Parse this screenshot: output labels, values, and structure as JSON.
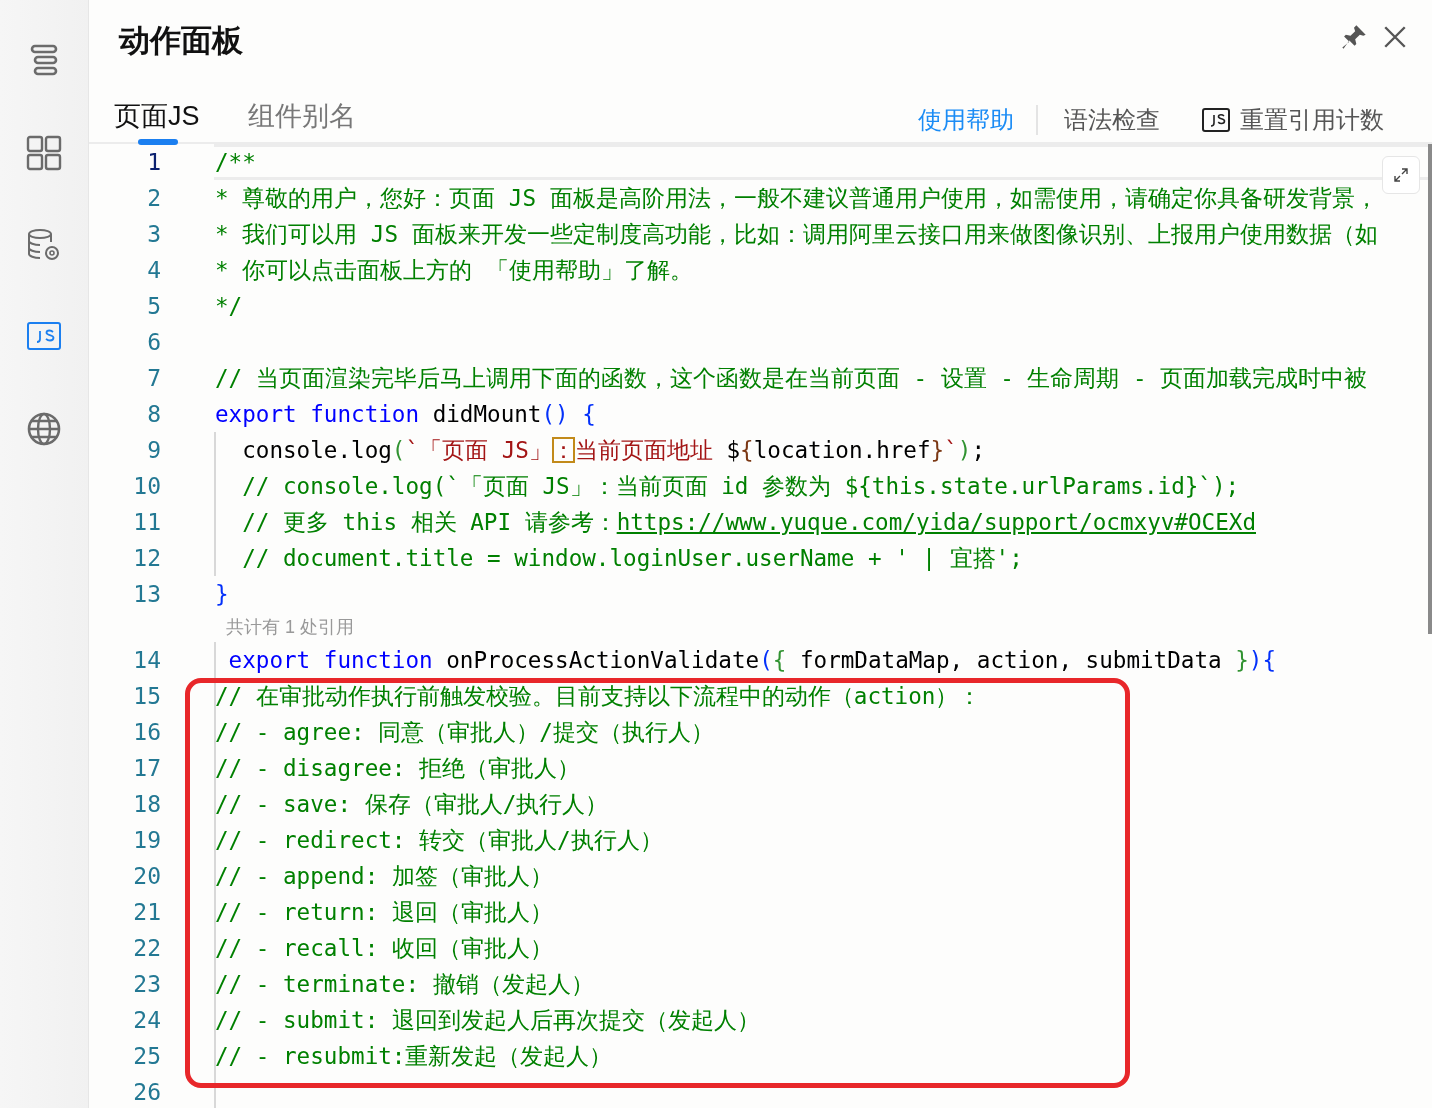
{
  "sidebar": {
    "items": [
      {
        "kind": "outline",
        "selected": false
      },
      {
        "kind": "components",
        "selected": false
      },
      {
        "kind": "datasource",
        "selected": false
      },
      {
        "kind": "js",
        "selected": true
      },
      {
        "kind": "globe",
        "selected": false
      }
    ]
  },
  "panel": {
    "title": "动作面板"
  },
  "tabs": [
    {
      "label": "页面JS",
      "selected": true
    },
    {
      "label": "组件别名",
      "selected": false
    }
  ],
  "actions": [
    {
      "kind": "link",
      "label": "使用帮助"
    },
    {
      "kind": "plain",
      "label": "语法检查"
    },
    {
      "kind": "js",
      "label": "重置引用计数"
    }
  ],
  "editor": {
    "lines": [
      {
        "kind": "code",
        "number": "1",
        "current": true,
        "tokens": [
          {
            "kind": "comment",
            "text": "/**"
          }
        ]
      },
      {
        "kind": "code",
        "number": "2",
        "current": false,
        "tokens": [
          {
            "kind": "comment",
            "text": "* 尊敬的用户，您好：页面 JS 面板是高阶用法，一般不建议普通用户使用，如需使用，请确定你具备研发背景，"
          }
        ]
      },
      {
        "kind": "code",
        "number": "3",
        "current": false,
        "tokens": [
          {
            "kind": "comment",
            "text": "* 我们可以用 JS 面板来开发一些定制度高功能，比如：调用阿里云接口用来做图像识别、上报用户使用数据（如"
          }
        ]
      },
      {
        "kind": "code",
        "number": "4",
        "current": false,
        "tokens": [
          {
            "kind": "comment",
            "text": "* 你可以点击面板上方的 「使用帮助」了解。"
          }
        ]
      },
      {
        "kind": "code",
        "number": "5",
        "current": false,
        "tokens": [
          {
            "kind": "comment",
            "text": "*/"
          }
        ]
      },
      {
        "kind": "code",
        "number": "6",
        "current": false
      },
      {
        "kind": "code",
        "number": "7",
        "current": false,
        "tokens": [
          {
            "kind": "comment",
            "text": "// 当页面渲染完毕后马上调用下面的函数，这个函数是在当前页面 - 设置 - 生命周期 - 页面加载完成时中被"
          }
        ]
      },
      {
        "kind": "code",
        "number": "8",
        "current": false,
        "tokens": [
          {
            "kind": "keyword",
            "text": "export function"
          },
          {
            "kind": "plain",
            "text": " didMount"
          },
          {
            "kind": "bracket1",
            "text": "() {"
          }
        ]
      },
      {
        "kind": "code",
        "number": "9",
        "current": false,
        "tokens": [
          {
            "kind": "plain",
            "text": "  console.log"
          },
          {
            "kind": "bracket2",
            "text": "("
          },
          {
            "kind": "string",
            "text": "`「页面 JS」"
          },
          {
            "kind": "match",
            "text": "："
          },
          {
            "kind": "string",
            "text": "当前页面地址 "
          },
          {
            "kind": "plain",
            "text": "$"
          },
          {
            "kind": "bracket3",
            "text": "{"
          },
          {
            "kind": "plain",
            "text": "location.href"
          },
          {
            "kind": "bracket3",
            "text": "}"
          },
          {
            "kind": "string",
            "text": "`"
          },
          {
            "kind": "bracket2",
            "text": ")"
          },
          {
            "kind": "plain",
            "text": ";"
          }
        ]
      },
      {
        "kind": "code",
        "number": "10",
        "current": false,
        "tokens": [
          {
            "kind": "comment",
            "text": "  // console.log(`「页面 JS」：当前页面 id 参数为 ${this.state.urlParams.id}`);"
          }
        ]
      },
      {
        "kind": "code",
        "number": "11",
        "current": false,
        "tokens": [
          {
            "kind": "comment",
            "text": "  // 更多 this 相关 API 请参考："
          },
          {
            "kind": "link",
            "text": "https://www.yuque.com/yida/support/ocmxyv#OCEXd"
          }
        ]
      },
      {
        "kind": "code",
        "number": "12",
        "current": false,
        "tokens": [
          {
            "kind": "comment",
            "text": "  // document.title = window.loginUser.userName + ' | 宜搭';"
          }
        ]
      },
      {
        "kind": "code",
        "number": "13",
        "current": false,
        "tokens": [
          {
            "kind": "bracket1",
            "text": "}"
          }
        ]
      },
      {
        "kind": "codelens",
        "text": "共计有 1 处引用"
      },
      {
        "kind": "code",
        "number": "14",
        "current": false,
        "tokens": [
          {
            "kind": "keyword",
            "text": " export function"
          },
          {
            "kind": "plain",
            "text": " onProcessActionValidate"
          },
          {
            "kind": "bracket1",
            "text": "("
          },
          {
            "kind": "bracket2",
            "text": "{"
          },
          {
            "kind": "plain",
            "text": " formDataMap, action, submitData "
          },
          {
            "kind": "bracket2",
            "text": "}"
          },
          {
            "kind": "bracket1",
            "text": ")"
          },
          {
            "kind": "bracket1",
            "text": "{"
          }
        ]
      },
      {
        "kind": "code",
        "number": "15",
        "current": false,
        "tokens": [
          {
            "kind": "comment",
            "text": "// 在审批动作执行前触发校验。目前支持以下流程中的动作（action）："
          }
        ]
      },
      {
        "kind": "code",
        "number": "16",
        "current": false,
        "tokens": [
          {
            "kind": "comment",
            "text": "// - agree: 同意（审批人）/提交（执行人）"
          }
        ]
      },
      {
        "kind": "code",
        "number": "17",
        "current": false,
        "tokens": [
          {
            "kind": "comment",
            "text": "// - disagree: 拒绝（审批人）"
          }
        ]
      },
      {
        "kind": "code",
        "number": "18",
        "current": false,
        "tokens": [
          {
            "kind": "comment",
            "text": "// - save: 保存（审批人/执行人）"
          }
        ]
      },
      {
        "kind": "code",
        "number": "19",
        "current": false,
        "tokens": [
          {
            "kind": "comment",
            "text": "// - redirect: 转交（审批人/执行人）"
          }
        ]
      },
      {
        "kind": "code",
        "number": "20",
        "current": false,
        "tokens": [
          {
            "kind": "comment",
            "text": "// - append: 加签（审批人）"
          }
        ]
      },
      {
        "kind": "code",
        "number": "21",
        "current": false,
        "tokens": [
          {
            "kind": "comment",
            "text": "// - return: 退回（审批人）"
          }
        ]
      },
      {
        "kind": "code",
        "number": "22",
        "current": false,
        "tokens": [
          {
            "kind": "comment",
            "text": "// - recall: 收回（审批人）"
          }
        ]
      },
      {
        "kind": "code",
        "number": "23",
        "current": false,
        "tokens": [
          {
            "kind": "comment",
            "text": "// - terminate: 撤销（发起人）"
          }
        ]
      },
      {
        "kind": "code",
        "number": "24",
        "current": false,
        "tokens": [
          {
            "kind": "comment",
            "text": "// - submit: 退回到发起人后再次提交（发起人）"
          }
        ]
      },
      {
        "kind": "code",
        "number": "25",
        "current": false,
        "tokens": [
          {
            "kind": "comment",
            "text": "// - resubmit:重新发起（发起人）"
          }
        ]
      },
      {
        "kind": "code",
        "number": "26",
        "current": false
      }
    ]
  }
}
